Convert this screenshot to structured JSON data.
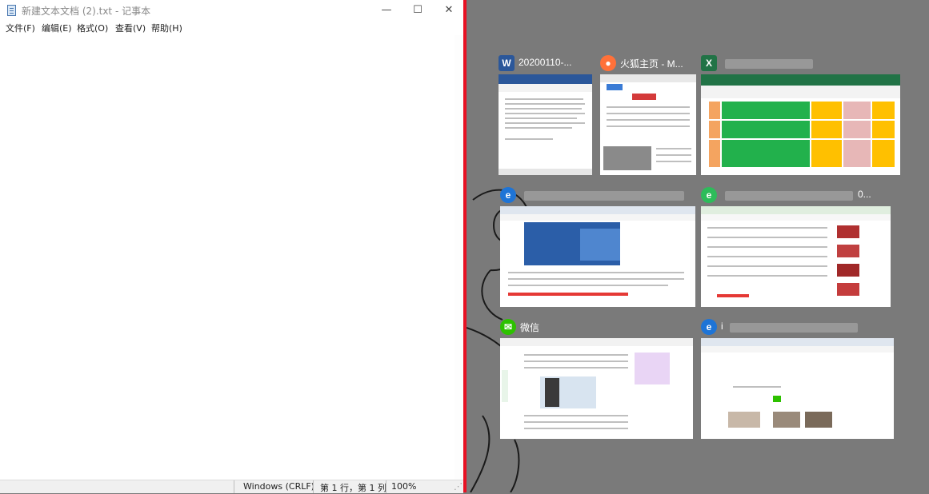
{
  "notepad": {
    "title": "新建文本文档 (2).txt - 记事本",
    "controls": {
      "minimize": "—",
      "maximize": "☐",
      "close": "✕"
    },
    "menu": [
      "文件(F)",
      "编辑(E)",
      "格式(O)",
      "查看(V)",
      "帮助(H)"
    ],
    "content": "",
    "status": {
      "line_ending": "Windows (CRLF)",
      "position": "第 1 行，第 1 列",
      "zoom": "100%"
    }
  },
  "snap_assist": {
    "windows": [
      {
        "app": "Word",
        "icon": "word-icon",
        "title": "20200110-..."
      },
      {
        "app": "Firefox",
        "icon": "firefox-icon",
        "title": "火狐主页 - M..."
      },
      {
        "app": "Excel",
        "icon": "excel-icon",
        "title": ""
      },
      {
        "app": "Browser",
        "icon": "browser-icon",
        "title": ""
      },
      {
        "app": "360 Browser",
        "icon": "browser-360-icon",
        "title": "0..."
      },
      {
        "app": "WeChat",
        "icon": "wechat-icon",
        "title": "微信"
      },
      {
        "app": "Browser",
        "icon": "browser-icon",
        "title": "i"
      }
    ]
  },
  "colors": {
    "snap_divider": "#e81123",
    "desktop": "#7a7a7a"
  }
}
